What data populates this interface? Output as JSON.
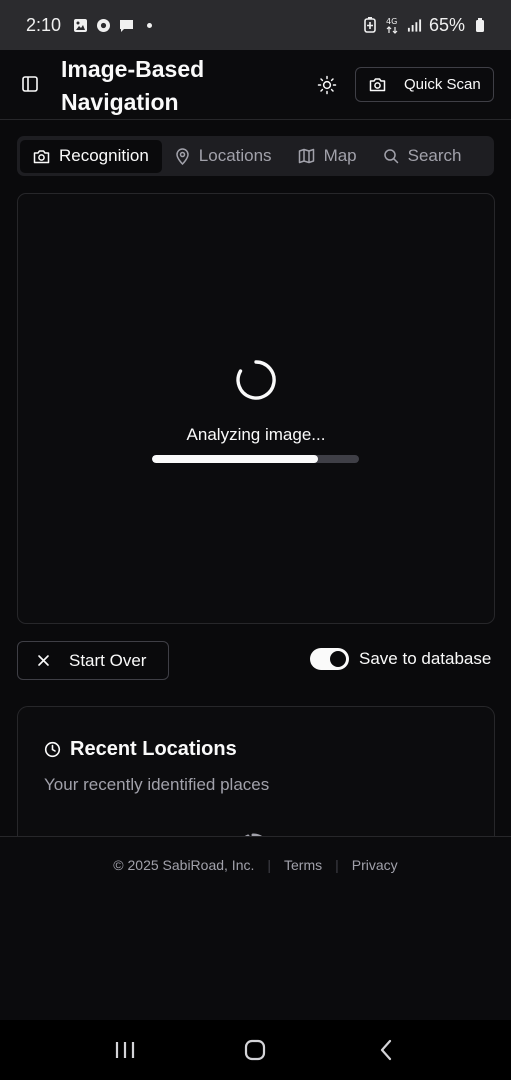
{
  "status_bar": {
    "time": "2:10",
    "battery_percent": "65%",
    "icons": [
      "gallery-icon",
      "chrome-icon",
      "chat-icon",
      "dot-icon",
      "battery-saver-icon",
      "4g-icon",
      "signal-icon",
      "battery-icon"
    ]
  },
  "header": {
    "title": "Image-Based Navigation",
    "quick_scan_label": "Quick Scan"
  },
  "tabs": [
    {
      "label": "Recognition",
      "icon": "camera-icon",
      "active": true
    },
    {
      "label": "Locations",
      "icon": "map-pin-icon",
      "active": false
    },
    {
      "label": "Map",
      "icon": "map-icon",
      "active": false
    },
    {
      "label": "Search",
      "icon": "search-icon",
      "active": false
    }
  ],
  "analysis": {
    "status_text": "Analyzing image...",
    "progress": 0.8
  },
  "actions": {
    "start_over_label": "Start Over",
    "save_to_database_label": "Save to database",
    "save_to_database_on": true
  },
  "recent": {
    "title": "Recent Locations",
    "subtitle": "Your recently identified places"
  },
  "footer": {
    "copyright": "© 2025 SabiRoad, Inc.",
    "terms": "Terms",
    "privacy": "Privacy"
  },
  "colors": {
    "background": "#0a0a0c",
    "text": "#fafafa",
    "muted": "#a1a1aa",
    "border": "#27272a"
  }
}
